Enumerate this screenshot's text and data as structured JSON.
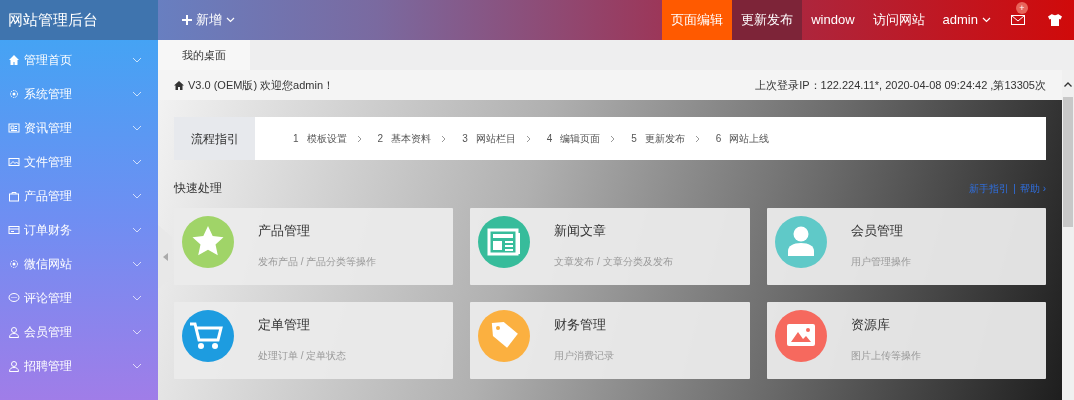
{
  "logo": "网站管理后台",
  "add_menu": {
    "label": "新增"
  },
  "top_nav": [
    {
      "label": "页面编辑",
      "kind": "highlight"
    },
    {
      "label": "更新发布",
      "kind": "dark"
    },
    {
      "label": "window",
      "kind": "plain"
    },
    {
      "label": "访问网站",
      "kind": "plain"
    },
    {
      "label": "admin",
      "kind": "dropdown"
    }
  ],
  "mail_badge": "+",
  "sidebar": {
    "items": [
      {
        "label": "管理首页",
        "expanded": false
      },
      {
        "label": "系统管理",
        "expanded": false
      },
      {
        "label": "资讯管理",
        "expanded": false
      },
      {
        "label": "文件管理",
        "expanded": false
      },
      {
        "label": "产品管理",
        "expanded": false
      },
      {
        "label": "订单财务",
        "expanded": false
      },
      {
        "label": "微信网站",
        "expanded": false
      },
      {
        "label": "评论管理",
        "expanded": false
      },
      {
        "label": "会员管理",
        "expanded": false
      },
      {
        "label": "招聘管理",
        "expanded": false
      }
    ]
  },
  "tabs": [
    {
      "label": "我的桌面",
      "selected": true
    }
  ],
  "welcome": "V3.0 (OEM版) 欢迎您admin！",
  "login_info": "上次登录IP：122.224.11*, 2020-04-08 09:24:42 ,第13305次",
  "guide": {
    "title": "流程指引",
    "steps": [
      {
        "number": "1",
        "label": "模板设置"
      },
      {
        "number": "2",
        "label": "基本资料"
      },
      {
        "number": "3",
        "label": "网站栏目"
      },
      {
        "number": "4",
        "label": "编辑页面"
      },
      {
        "number": "5",
        "label": "更新发布"
      },
      {
        "number": "6",
        "label": "网站上线"
      }
    ]
  },
  "quick": {
    "title": "快速处理",
    "links": [
      "新手指引",
      "帮助 ›"
    ],
    "separator": "|",
    "cards": [
      {
        "title": "产品管理",
        "subtitle": "发布产品 / 产品分类等操作",
        "color": "#a0d468"
      },
      {
        "title": "新闻文章",
        "subtitle": "文章发布 / 文章分类及发布",
        "color": "#37bc9b"
      },
      {
        "title": "会员管理",
        "subtitle": "用户管理操作",
        "color": "#5fc9c8"
      },
      {
        "title": "定单管理",
        "subtitle": "处理订单 / 定单状态",
        "color": "#1d9ce0"
      },
      {
        "title": "财务管理",
        "subtitle": "用户消费记录",
        "color": "#fbb040"
      },
      {
        "title": "资源库",
        "subtitle": "图片上传等操作",
        "color": "#f6695e"
      }
    ]
  }
}
